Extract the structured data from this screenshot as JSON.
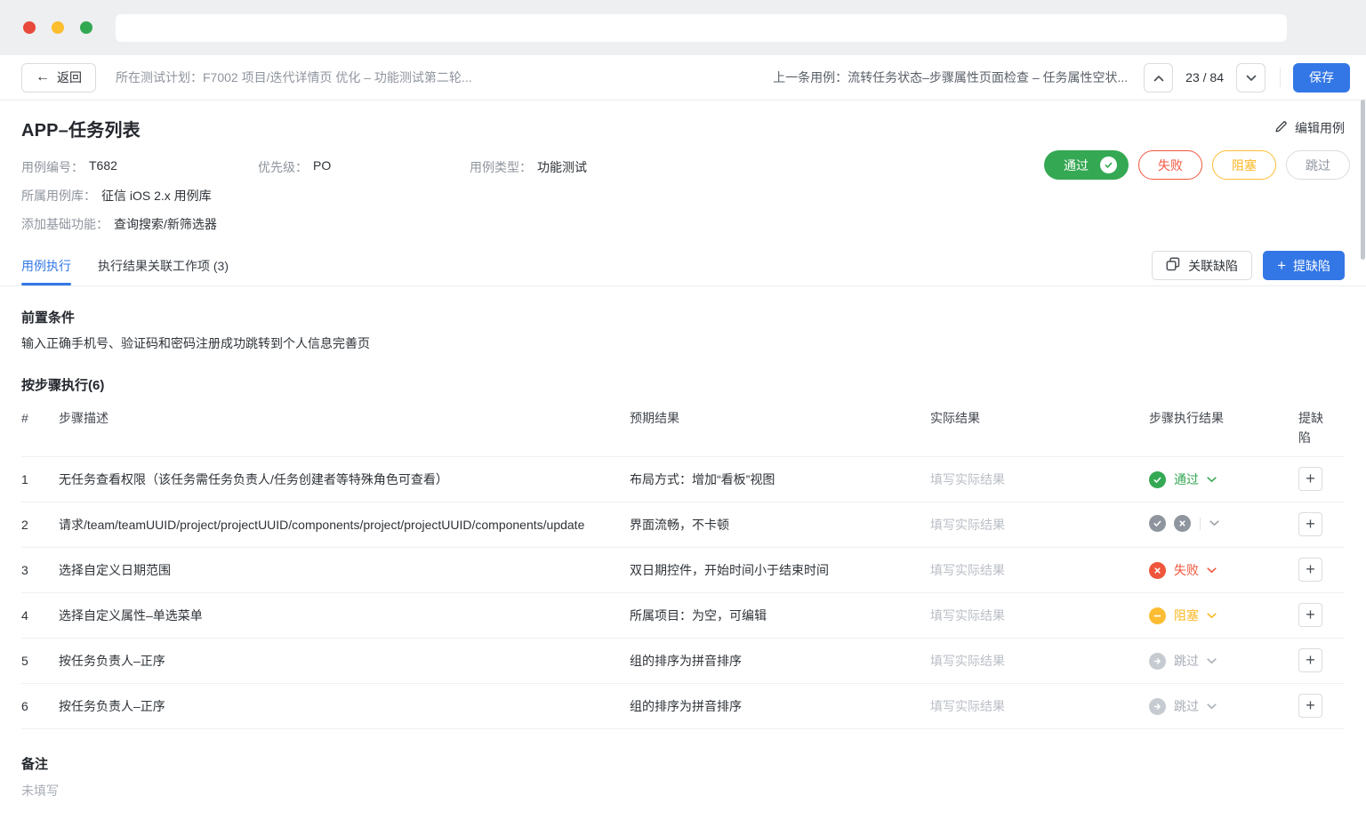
{
  "icons": {
    "back_arrow": "←",
    "plus": "+"
  },
  "toolbar": {
    "back_label": "返回",
    "plan_label": "所在测试计划：",
    "plan_value": "F7002 项目/迭代详情页 优化 – 功能测试第二轮...",
    "prev_label": "上一条用例：",
    "prev_value": "流转任务状态–步骤属性页面检查 – 任务属性空状...",
    "counter": "23 / 84",
    "save_label": "保存"
  },
  "case": {
    "title": "APP–任务列表",
    "edit_label": "编辑用例",
    "fields": [
      {
        "label": "用例编号：",
        "value": "T682"
      },
      {
        "label": "优先级：",
        "value": "PO"
      },
      {
        "label": "用例类型：",
        "value": "功能测试"
      },
      {
        "label": "所属用例库：",
        "value": "征信 iOS 2.x 用例库"
      },
      {
        "label": "添加基础功能：",
        "value": "查询搜索/新筛选器"
      }
    ],
    "status_buttons": [
      {
        "label": "通过",
        "state": "selected"
      },
      {
        "label": "失败",
        "state": "normal"
      },
      {
        "label": "阻塞",
        "state": "normal"
      },
      {
        "label": "跳过",
        "state": "normal"
      }
    ]
  },
  "tabs": [
    {
      "label": "用例执行",
      "active": true
    },
    {
      "label": "执行结果关联工作项 (3)",
      "active": false
    }
  ],
  "actions": {
    "link_defect_label": "关联缺陷",
    "new_defect_label": "提缺陷"
  },
  "precondition": {
    "heading": "前置条件",
    "text": "输入正确手机号、验证码和密码注册成功跳转到个人信息完善页"
  },
  "steps": {
    "heading": "按步骤执行(6)",
    "columns": [
      "#",
      "步骤描述",
      "预期结果",
      "实际结果",
      "步骤执行结果",
      "提缺陷"
    ],
    "actual_placeholder": "填写实际结果",
    "rows": [
      {
        "num": "1",
        "desc": "无任务查看权限（该任务需任务负责人/任务创建者等特殊角色可查看）",
        "expected": "布局方式：增加“看板”视图",
        "result": "通过",
        "result_state": "pass"
      },
      {
        "num": "2",
        "desc": "请求/team/teamUUID/project/projectUUID/components/project/projectUUID/components/update",
        "expected": "界面流畅，不卡顿",
        "result": "",
        "result_state": "unset"
      },
      {
        "num": "3",
        "desc": "选择自定义日期范围",
        "expected": "双日期控件，开始时间小于结束时间",
        "result": "失败",
        "result_state": "fail"
      },
      {
        "num": "4",
        "desc": "选择自定义属性–单选菜单",
        "expected": "所属项目：为空，可编辑",
        "result": "阻塞",
        "result_state": "block"
      },
      {
        "num": "5",
        "desc": "按任务负责人–正序",
        "expected": "组的排序为拼音排序",
        "result": "跳过",
        "result_state": "skip"
      },
      {
        "num": "6",
        "desc": "按任务负责人–正序",
        "expected": "组的排序为拼音排序",
        "result": "跳过",
        "result_state": "skip"
      }
    ]
  },
  "notes": {
    "heading": "备注",
    "value": "未填写"
  },
  "colors": {
    "accent_blue": "#3377e6",
    "pass_green": "#34a853",
    "fail_red": "#f0563c",
    "block_amber": "#fcbd33",
    "skip_gray": "#a7acb4"
  }
}
